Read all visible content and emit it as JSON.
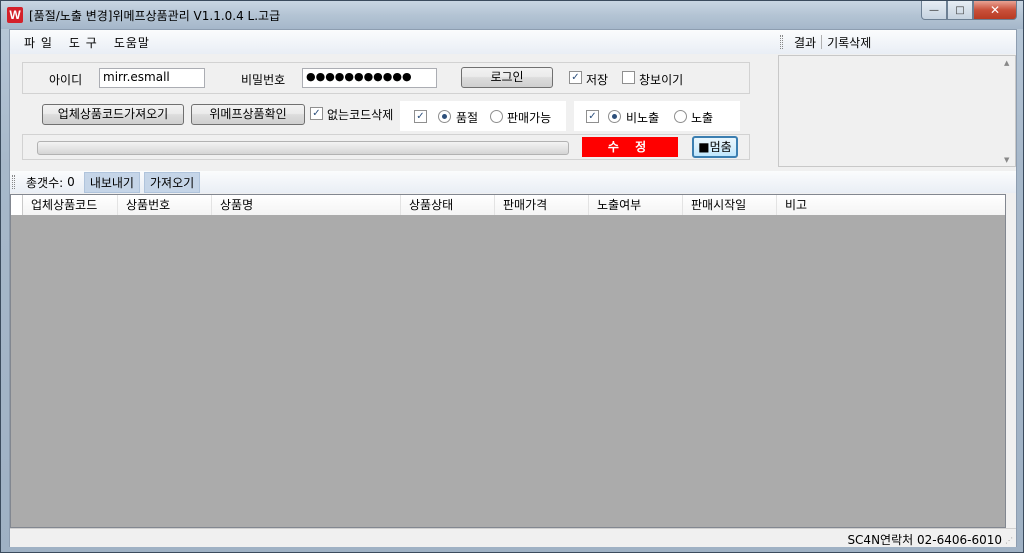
{
  "window": {
    "title": "[품절/노출 변경]위메프상품관리 V1.1.0.4 L.고급",
    "icon_letter": "W",
    "minimize": "—",
    "maximize": "□",
    "close": "✕"
  },
  "menu": {
    "items": [
      "파 일",
      "도 구",
      "도움말"
    ]
  },
  "login": {
    "id_label": "아이디",
    "id_value": "mirr.esmall",
    "pw_label": "비밀번호",
    "pw_value": "●●●●●●●●●●●",
    "login_button": "로그인",
    "save_label": "저장",
    "save_checked": true,
    "show_window_label": "창보이기",
    "show_window_checked": false
  },
  "actions": {
    "fetch_codes_button": "업체상품코드가져오기",
    "confirm_button": "위메프상품확인",
    "delete_missing_label": "없는코드삭제",
    "delete_missing_checked": true,
    "soldout_group": {
      "enabled": true,
      "options": [
        "품절",
        "판매가능"
      ],
      "selected": "품절"
    },
    "exposure_group": {
      "enabled": true,
      "options": [
        "비노출",
        "노출"
      ],
      "selected": "비노출"
    }
  },
  "progress": {
    "value_percent": 0,
    "fix_button": "수 정",
    "stop_button": "■멈춤"
  },
  "result_panel": {
    "tabs": [
      "결과",
      "기록삭제"
    ]
  },
  "toolbar": {
    "total_label": "총갯수:",
    "total_count": "0",
    "export_button": "내보내기",
    "import_button": "가져오기"
  },
  "grid": {
    "columns": [
      "업체상품코드",
      "상품번호",
      "상품명",
      "상품상태",
      "판매가격",
      "노출여부",
      "판매시작일",
      "비고"
    ]
  },
  "statusbar": {
    "contact": "SC4N연락처 02-6406-6010"
  },
  "colors": {
    "fix_button_bg": "#ff0000",
    "grid_bg": "#ababab",
    "progress_fill": "#3bc13b"
  }
}
